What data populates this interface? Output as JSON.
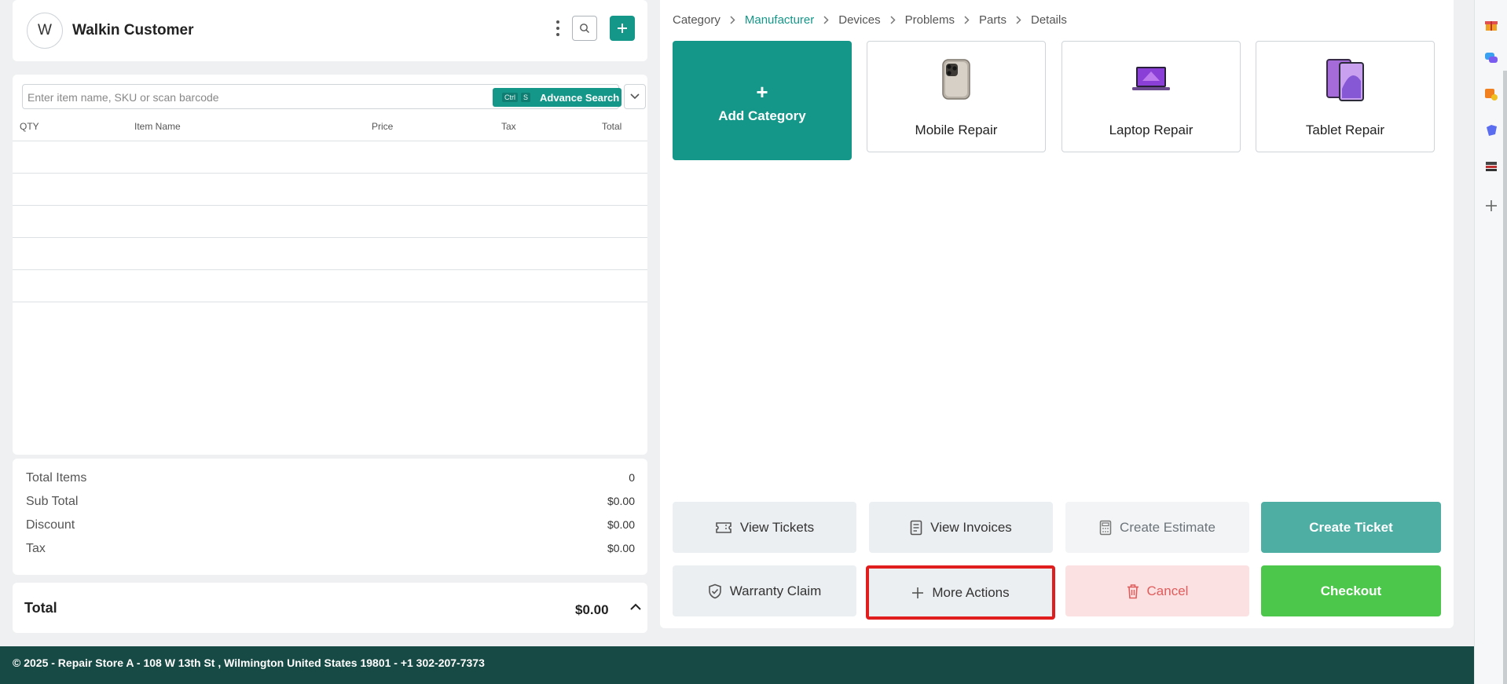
{
  "customer": {
    "avatar_letter": "W",
    "name": "Walkin Customer",
    "icons": [
      "more-vertical-icon",
      "search-icon",
      "plus-icon"
    ]
  },
  "item_search": {
    "placeholder": "Enter item name, SKU or scan barcode",
    "kbd_ctrl": "Ctrl",
    "kbd_key": "S",
    "advance_search_label": "Advance Search"
  },
  "table": {
    "columns": [
      "QTY",
      "Item Name",
      "Price",
      "Tax",
      "Total"
    ],
    "rows": []
  },
  "totals": {
    "items": [
      {
        "label": "Total Items",
        "value": "0"
      },
      {
        "label": "Sub Total",
        "value": "$0.00"
      },
      {
        "label": "Discount",
        "value": "$0.00"
      },
      {
        "label": "Tax",
        "value": "$0.00"
      }
    ],
    "grand_label": "Total",
    "grand_value": "$0.00"
  },
  "breadcrumbs": [
    {
      "label": "Category",
      "active": false
    },
    {
      "label": "Manufacturer",
      "active": true
    },
    {
      "label": "Devices",
      "active": false
    },
    {
      "label": "Problems",
      "active": false
    },
    {
      "label": "Parts",
      "active": false
    },
    {
      "label": "Details",
      "active": false
    }
  ],
  "categories": {
    "add_plus": "+",
    "add_label": "Add Category",
    "tiles": [
      {
        "label": "Mobile Repair",
        "icon": "phone-image"
      },
      {
        "label": "Laptop Repair",
        "icon": "laptop-image"
      },
      {
        "label": "Tablet Repair",
        "icon": "tablet-image"
      }
    ]
  },
  "actions": {
    "view_tickets": "View Tickets",
    "view_invoices": "View Invoices",
    "create_estimate": "Create Estimate",
    "create_ticket": "Create Ticket",
    "warranty_claim": "Warranty Claim",
    "more_actions": "More Actions",
    "cancel": "Cancel",
    "checkout": "Checkout"
  },
  "footer": {
    "text": "© 2025 - Repair Store A - 108 W 13th St , Wilmington United States 19801 - +1 302-207-7373"
  },
  "colors": {
    "brand_teal": "#149688",
    "create_ticket": "#4eaea3",
    "checkout_green": "#4cc74c",
    "cancel_bg": "#fbe1e1",
    "cancel_text": "#e05c5c",
    "footer_bg": "#174a44",
    "highlight_red": "#e01e1e"
  }
}
